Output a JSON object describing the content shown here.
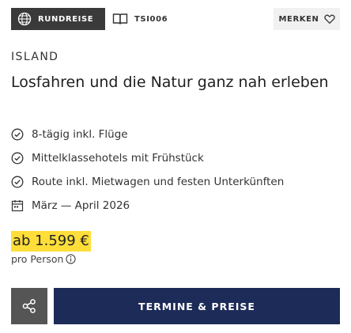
{
  "header": {
    "badge_label": "RUNDREISE",
    "badge_icon": "globe-icon",
    "trip_code": "TSI006",
    "code_icon": "book-icon",
    "merken_label": "MERKEN",
    "merken_icon": "heart-icon"
  },
  "trip": {
    "country": "ISLAND",
    "title": "Losfahren und die Natur ganz nah erleben",
    "features": [
      {
        "icon": "check-circle-icon",
        "text": "8-tägig inkl. Flüge"
      },
      {
        "icon": "check-circle-icon",
        "text": "Mittelklassehotels mit Frühstück"
      },
      {
        "icon": "check-circle-icon",
        "text": "Route inkl. Mietwagen und festen Unterkünften"
      },
      {
        "icon": "calendar-icon",
        "text": "März — April 2026"
      }
    ]
  },
  "pricing": {
    "price": "ab 1.599 €",
    "per_person": "pro Person",
    "info_icon": "info-icon",
    "highlight_color": "#ffde3a"
  },
  "actions": {
    "share_icon": "share-icon",
    "cta_label": "TERMINE & PREISE"
  },
  "colors": {
    "badge_bg": "#3a3a3a",
    "cta_bg": "#1d2b58",
    "share_bg": "#555555"
  }
}
